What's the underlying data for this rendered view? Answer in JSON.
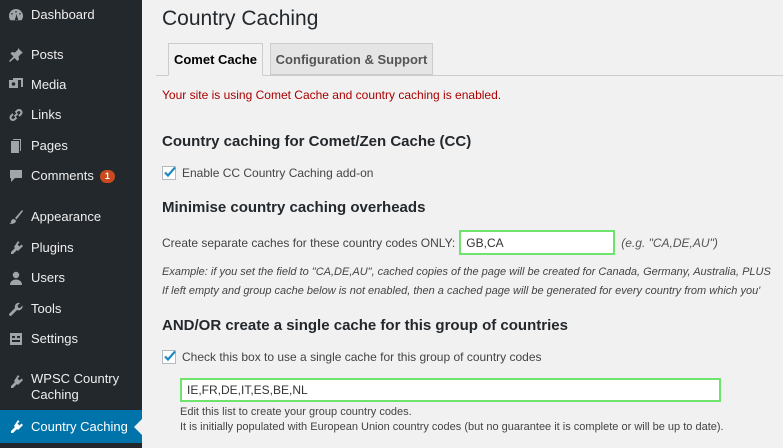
{
  "sidebar": {
    "items": [
      {
        "label": "Dashboard",
        "icon": "dashboard-icon"
      },
      {
        "label": "Posts",
        "icon": "pin-icon"
      },
      {
        "label": "Media",
        "icon": "media-icon"
      },
      {
        "label": "Links",
        "icon": "links-icon"
      },
      {
        "label": "Pages",
        "icon": "pages-icon"
      },
      {
        "label": "Comments",
        "icon": "comments-icon",
        "badge": "1"
      },
      {
        "label": "Appearance",
        "icon": "brush-icon"
      },
      {
        "label": "Plugins",
        "icon": "plugin-icon"
      },
      {
        "label": "Users",
        "icon": "users-icon"
      },
      {
        "label": "Tools",
        "icon": "wrench-icon"
      },
      {
        "label": "Settings",
        "icon": "settings-icon"
      },
      {
        "label": "WPSC Country Caching",
        "icon": "plugin-icon"
      },
      {
        "label": "Country Caching",
        "icon": "plugin-icon",
        "active": true
      }
    ]
  },
  "page": {
    "title": "Country Caching",
    "tabs": [
      {
        "label": "Comet Cache",
        "active": true
      },
      {
        "label": "Configuration & Support",
        "active": false
      }
    ],
    "notice": "Your site is using Comet Cache and country caching is enabled."
  },
  "section1": {
    "heading": "Country caching for Comet/Zen Cache (CC)",
    "enable_label": "Enable CC Country Caching add-on",
    "enable_checked": true
  },
  "section2": {
    "heading": "Minimise country caching overheads",
    "field_label": "Create separate caches for these country codes ONLY:",
    "field_value": "GB,CA",
    "field_example": "(e.g. \"CA,DE,AU\")",
    "note1": "Example: if you set the field to \"CA,DE,AU\", cached copies of the page will be created for Canada, Germany, Australia, PLUS",
    "note2": "If left empty and group cache below is not enabled, then a cached page will be generated for every country from which you'"
  },
  "section3": {
    "heading": "AND/OR create a single cache for this group of countries",
    "group_label": "Check this box to use a single cache for this group of country codes",
    "group_checked": true,
    "group_value": "IE,FR,DE,IT,ES,BE,NL",
    "help1": "Edit this list to create your group country codes.",
    "help2": "It is initially populated with European Union country codes (but no guarantee it is complete or will be up to date)."
  },
  "colors": {
    "sidebar_bg": "#23282d",
    "active_bg": "#0073aa",
    "notice_text": "#aa0000",
    "field_border": "#6ee36e",
    "check_mark": "#1e8cbe",
    "badge_bg": "#ca4a1f"
  }
}
